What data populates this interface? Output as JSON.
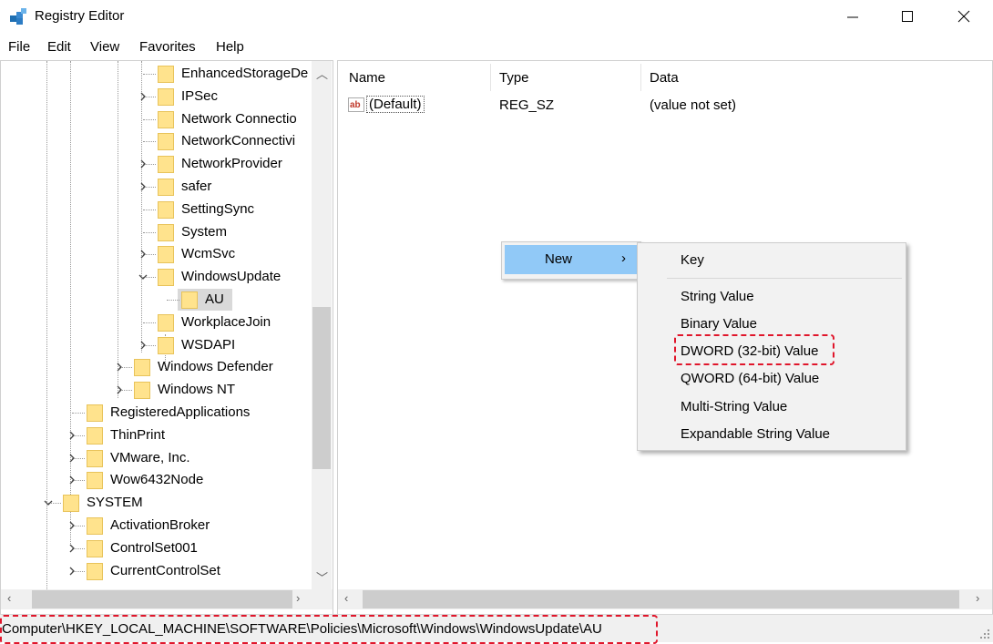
{
  "window": {
    "title": "Registry Editor"
  },
  "menu": [
    "File",
    "Edit",
    "View",
    "Favorites",
    "Help"
  ],
  "tree": [
    {
      "label": "EnhancedStorageDe",
      "level": 3,
      "expander": "none"
    },
    {
      "label": "IPSec",
      "level": 3,
      "expander": "collapsed"
    },
    {
      "label": "Network Connectio",
      "level": 3,
      "expander": "none"
    },
    {
      "label": "NetworkConnectivi",
      "level": 3,
      "expander": "none"
    },
    {
      "label": "NetworkProvider",
      "level": 3,
      "expander": "collapsed"
    },
    {
      "label": "safer",
      "level": 3,
      "expander": "collapsed"
    },
    {
      "label": "SettingSync",
      "level": 3,
      "expander": "none"
    },
    {
      "label": "System",
      "level": 3,
      "expander": "none"
    },
    {
      "label": "WcmSvc",
      "level": 3,
      "expander": "collapsed"
    },
    {
      "label": "WindowsUpdate",
      "level": 3,
      "expander": "expanded"
    },
    {
      "label": "AU",
      "level": 4,
      "expander": "none",
      "selected": true
    },
    {
      "label": "WorkplaceJoin",
      "level": 3,
      "expander": "none"
    },
    {
      "label": "WSDAPI",
      "level": 3,
      "expander": "collapsed"
    },
    {
      "label": "Windows Defender",
      "level": 2,
      "expander": "collapsed"
    },
    {
      "label": "Windows NT",
      "level": 2,
      "expander": "collapsed"
    },
    {
      "label": "RegisteredApplications",
      "level": 1,
      "expander": "none"
    },
    {
      "label": "ThinPrint",
      "level": 1,
      "expander": "collapsed"
    },
    {
      "label": "VMware, Inc.",
      "level": 1,
      "expander": "collapsed"
    },
    {
      "label": "Wow6432Node",
      "level": 1,
      "expander": "collapsed"
    },
    {
      "label": "SYSTEM",
      "level": 0,
      "expander": "expanded"
    },
    {
      "label": "ActivationBroker",
      "level": 1,
      "expander": "collapsed"
    },
    {
      "label": "ControlSet001",
      "level": 1,
      "expander": "collapsed"
    },
    {
      "label": "CurrentControlSet",
      "level": 1,
      "expander": "collapsed"
    }
  ],
  "list": {
    "columns": {
      "name": "Name",
      "type": "Type",
      "data": "Data"
    },
    "rows": [
      {
        "name": "(Default)",
        "type": "REG_SZ",
        "data": "(value not set)"
      }
    ]
  },
  "context_menu": {
    "new_label": "New",
    "arrow": "›"
  },
  "submenu": {
    "key": "Key",
    "items": [
      "String Value",
      "Binary Value",
      "DWORD (32-bit) Value",
      "QWORD (64-bit) Value",
      "Multi-String Value",
      "Expandable String Value"
    ]
  },
  "status": {
    "path": "Computer\\HKEY_LOCAL_MACHINE\\SOFTWARE\\Policies\\Microsoft\\Windows\\WindowsUpdate\\AU"
  },
  "colors": {
    "highlight": "#e0162b",
    "menu_hover": "#91c9f7",
    "folder": "#ffe38d"
  }
}
